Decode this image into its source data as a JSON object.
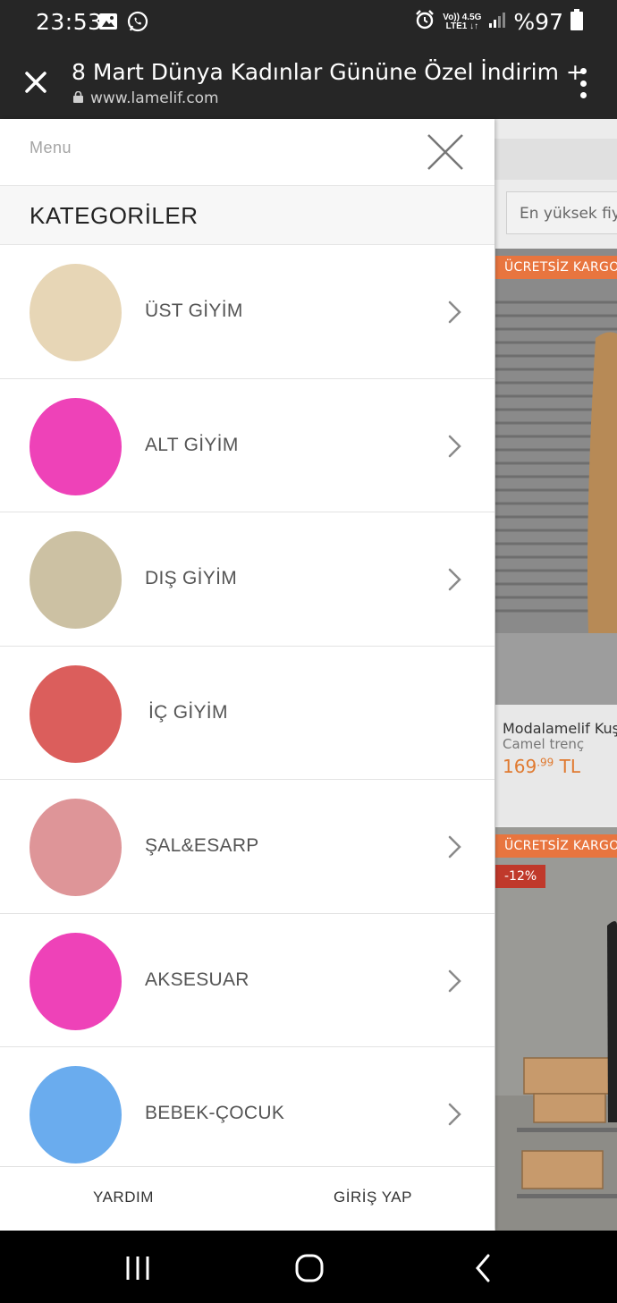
{
  "status_bar": {
    "time": "23:53",
    "left_icons": [
      "image-icon",
      "whatsapp-icon"
    ],
    "network_top": "Vo)) 4.5G",
    "network_bottom": "LTE1 ↓↑",
    "battery": "%97"
  },
  "browser": {
    "title": "8 Mart Dünya Kadınlar Gününe Özel İndirim +",
    "url": "www.lamelif.com"
  },
  "drawer": {
    "menu_label": "Menu",
    "heading": "KATEGORİLER",
    "categories": [
      {
        "label": "ÜST GİYİM",
        "color": "#E7D6B6",
        "has_chevron": true
      },
      {
        "label": "ALT GİYİM",
        "color": "#EE42B8",
        "has_chevron": true
      },
      {
        "label": "DIŞ GİYİM",
        "color": "#CCC1A3",
        "has_chevron": true
      },
      {
        "label": "İÇ GİYİM",
        "color": "#DB5E5C",
        "has_chevron": false
      },
      {
        "label": "ŞAL&ESARP",
        "color": "#DE9598",
        "has_chevron": true
      },
      {
        "label": "AKSESUAR",
        "color": "#EE42B8",
        "has_chevron": true
      },
      {
        "label": "BEBEK-ÇOCUK",
        "color": "#6AACEE",
        "has_chevron": true
      }
    ],
    "footer": {
      "help": "YARDIM",
      "login": "GİRİŞ YAP"
    }
  },
  "background_page": {
    "sort_value": "En yüksek fiyat",
    "products": [
      {
        "ribbon": "ÜCRETSİZ KARGO",
        "name": "Modalamelif Kuşaklı",
        "subtitle": "Camel trenç",
        "price_main": "169",
        "price_cents": ".99",
        "currency": "TL"
      },
      {
        "ribbon": "ÜCRETSİZ KARGO",
        "discount": "-12%"
      }
    ]
  },
  "nav_bar": {
    "buttons": [
      "recent-apps-icon",
      "home-icon",
      "back-icon"
    ]
  }
}
